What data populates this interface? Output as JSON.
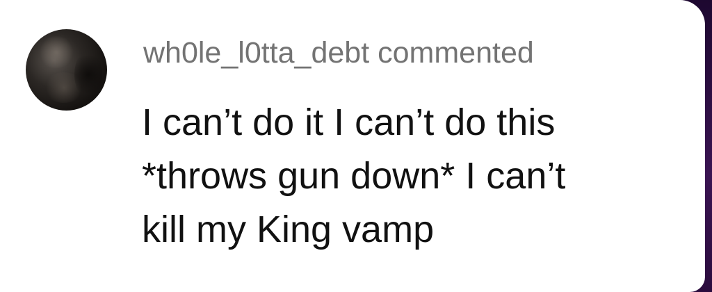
{
  "comment": {
    "username": "wh0le_l0tta_debt",
    "action": "commented",
    "text_lines": [
      "I can’t do it I can’t do this",
      "*throws gun down* I can’t",
      "kill my King vamp"
    ]
  },
  "colors": {
    "card_background": "#ffffff",
    "header_text": "#737373",
    "comment_text": "#111111",
    "backdrop": "#2a0c3f"
  }
}
